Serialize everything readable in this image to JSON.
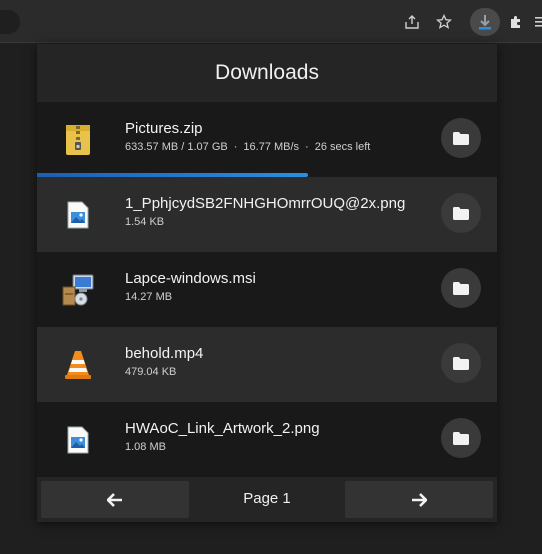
{
  "toolbar": {
    "icons": [
      "share-icon",
      "star-icon",
      "download-icon",
      "extensions-icon",
      "menu-icon"
    ]
  },
  "popup": {
    "title": "Downloads",
    "items": [
      {
        "icon": "zip-archive-icon",
        "name": "Pictures.zip",
        "size": "633.57 MB / 1.07 GB",
        "speed": "16.77 MB/s",
        "remaining": "26 secs left",
        "progress": 0.59
      },
      {
        "icon": "image-file-icon",
        "name": "1_PphjcydSB2FNHGHOmrrOUQ@2x.png",
        "size": "1.54 KB"
      },
      {
        "icon": "installer-icon",
        "name": "Lapce-windows.msi",
        "size": "14.27 MB"
      },
      {
        "icon": "vlc-cone-icon",
        "name": "behold.mp4",
        "size": "479.04 KB"
      },
      {
        "icon": "image-file-icon",
        "name": "HWAoC_Link_Artwork_2.png",
        "size": "1.08 MB"
      }
    ],
    "pager": {
      "label": "Page 1",
      "prev_icon": "arrow-left-icon",
      "next_icon": "arrow-right-icon"
    }
  },
  "colors": {
    "background": "#1f1f1f",
    "progress": "#2a8fe0"
  }
}
